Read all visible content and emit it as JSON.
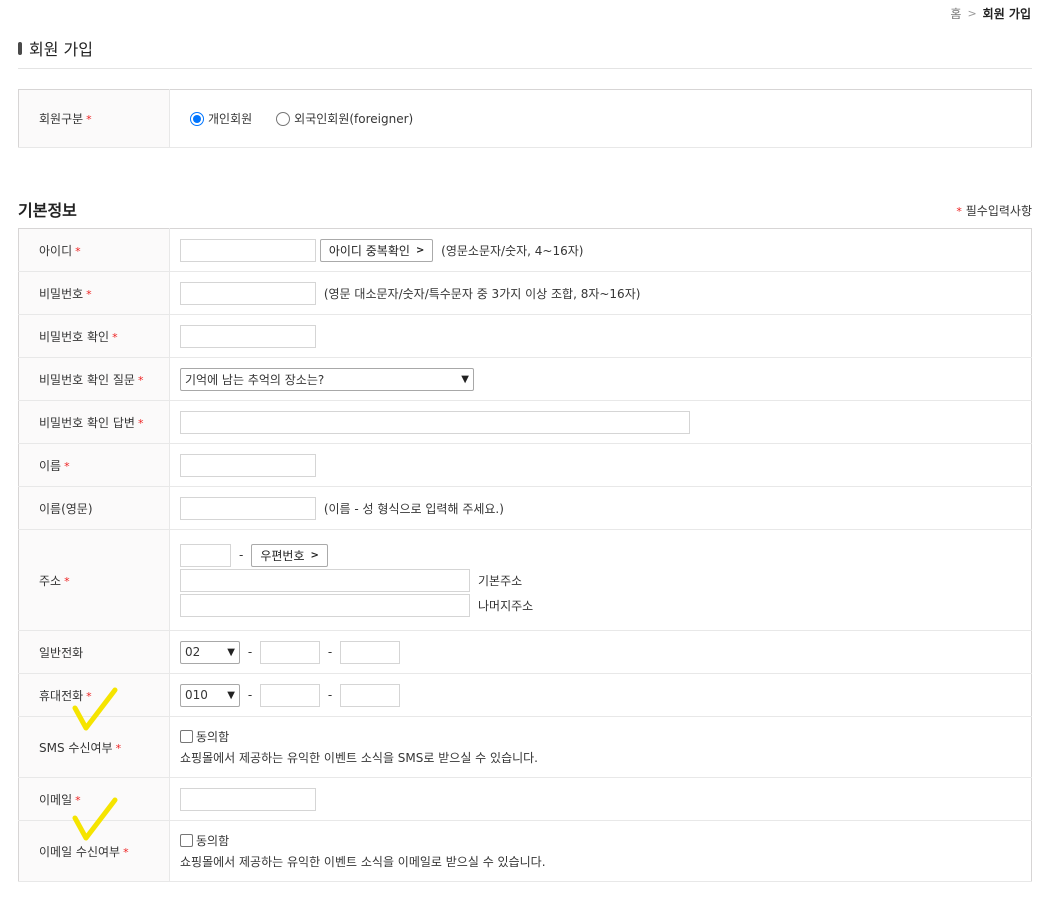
{
  "breadcrumb": {
    "home": "홈",
    "current": "회원 가입"
  },
  "page_title": "회원 가입",
  "member_type": {
    "label": "회원구분",
    "options": [
      "개인회원",
      "외국인회원(foreigner)"
    ],
    "selected": "개인회원"
  },
  "section_title": "기본정보",
  "required_note": "필수입력사항",
  "required_mark": "*",
  "fields": {
    "id": {
      "label": "아이디",
      "button": "아이디 중복확인",
      "hint": "(영문소문자/숫자, 4~16자)"
    },
    "password": {
      "label": "비밀번호",
      "hint": "(영문 대소문자/숫자/특수문자 중 3가지 이상 조합, 8자~16자)"
    },
    "password_confirm": {
      "label": "비밀번호 확인"
    },
    "password_question": {
      "label": "비밀번호 확인 질문",
      "selected": "기억에 남는 추억의 장소는?"
    },
    "password_answer": {
      "label": "비밀번호 확인 답변"
    },
    "name": {
      "label": "이름"
    },
    "name_en": {
      "label": "이름(영문)",
      "hint": "(이름 - 성 형식으로 입력해 주세요.)"
    },
    "address": {
      "label": "주소",
      "zip_button": "우편번호",
      "basic_label": "기본주소",
      "detail_label": "나머지주소"
    },
    "phone": {
      "label": "일반전화",
      "area_code": "02"
    },
    "mobile": {
      "label": "휴대전화",
      "prefix": "010"
    },
    "sms": {
      "label": "SMS 수신여부",
      "agree": "동의함",
      "desc": "쇼핑몰에서 제공하는 유익한 이벤트 소식을 SMS로 받으실 수 있습니다."
    },
    "email": {
      "label": "이메일"
    },
    "email_receive": {
      "label": "이메일 수신여부",
      "agree": "동의함",
      "desc": "쇼핑몰에서 제공하는 유익한 이벤트 소식을 이메일로 받으실 수 있습니다."
    }
  },
  "colors": {
    "accent": "#0075ff",
    "required": "#ee2222",
    "highlight": "#f5e400"
  }
}
